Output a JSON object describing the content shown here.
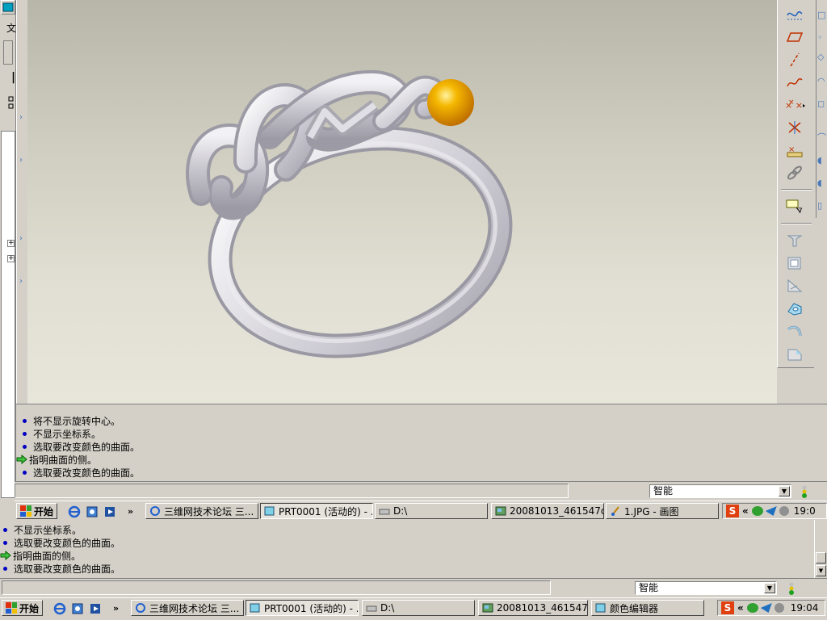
{
  "left_strip": {
    "label_wen": "文",
    "label_bar": "|"
  },
  "messages_top": [
    {
      "type": "info",
      "text": "将不显示旋转中心。"
    },
    {
      "type": "info",
      "text": "不显示坐标系。"
    },
    {
      "type": "info",
      "text": "选取要改变颜色的曲面。"
    },
    {
      "type": "prompt",
      "text": "指明曲面的侧。"
    },
    {
      "type": "info",
      "text": "选取要改变颜色的曲面。"
    }
  ],
  "filter_top": {
    "value": "智能"
  },
  "taskbar_top": {
    "start_label": "开始",
    "more": "»",
    "tasks": [
      {
        "label": "三维网技术论坛 三...",
        "icon": "ie-icon"
      },
      {
        "label": "PRT0001 (活动的) - ...",
        "icon": "proe-icon",
        "active": true
      },
      {
        "label": "D:\\",
        "icon": "drive-icon"
      },
      {
        "label": "20081013_461547d...",
        "icon": "image-icon"
      },
      {
        "label": "1.JPG - 画图",
        "icon": "paint-icon"
      }
    ],
    "tray_chevron": "«",
    "clock": "19:0"
  },
  "messages_bottom": [
    {
      "type": "info",
      "text": "不显示坐标系。"
    },
    {
      "type": "info",
      "text": "选取要改变颜色的曲面。"
    },
    {
      "type": "prompt",
      "text": "指明曲面的侧。"
    },
    {
      "type": "info",
      "text": "选取要改变颜色的曲面。"
    }
  ],
  "filter_bottom": {
    "value": "智能"
  },
  "taskbar_bottom": {
    "start_label": "开始",
    "more": "»",
    "tasks": [
      {
        "label": "三维网技术论坛 三...",
        "icon": "ie-icon"
      },
      {
        "label": "PRT0001 (活动的) - ...",
        "icon": "proe-icon",
        "active": true
      },
      {
        "label": "D:\\",
        "icon": "drive-icon"
      },
      {
        "label": "20081013_461547d...",
        "icon": "image-icon"
      },
      {
        "label": "颜色编辑器",
        "icon": "proe-icon"
      }
    ],
    "tray_chevron": "«",
    "clock": "19:04"
  },
  "colors": {
    "model": "#c9c7cf",
    "sphere": "#e6a000",
    "link": "#0000c0"
  }
}
